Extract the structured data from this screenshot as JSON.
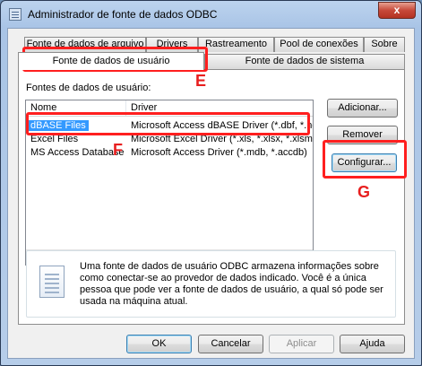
{
  "window": {
    "title": "Administrador de fonte de dados ODBC",
    "close_glyph": "x"
  },
  "tabs_back": [
    {
      "label": "Fonte de dados de arquivo"
    },
    {
      "label": "Drivers"
    },
    {
      "label": "Rastreamento"
    },
    {
      "label": "Pool de conexões"
    },
    {
      "label": "Sobre"
    }
  ],
  "tabs_front": [
    {
      "label": "Fonte de dados de usuário"
    },
    {
      "label": "Fonte de dados de sistema"
    }
  ],
  "panel": {
    "list_label": "Fontes de dados de usuário:",
    "columns": [
      "Nome",
      "Driver"
    ],
    "rows": [
      {
        "name": "dBASE Files",
        "driver": "Microsoft Access dBASE Driver (*.dbf, *.ndx"
      },
      {
        "name": "Excel Files",
        "driver": "Microsoft Excel Driver (*.xls, *.xlsx, *.xlsm, *.xlsb)"
      },
      {
        "name": "MS Access Database",
        "driver": "Microsoft Access Driver (*.mdb, *.accdb)"
      }
    ],
    "selected_row": 0,
    "buttons": {
      "add": "Adicionar...",
      "remove": "Remover",
      "configure": "Configurar..."
    },
    "info_text": "Uma fonte de dados de usuário ODBC armazena informações sobre como conectar-se ao provedor de dados indicado. Você é a única pessoa que pode ver a fonte de dados de usuário, a qual só pode ser usada na máquina atual."
  },
  "footer_buttons": {
    "ok": "OK",
    "cancel": "Cancelar",
    "apply": "Aplicar",
    "help": "Ajuda"
  },
  "annotations": {
    "tab_letter": "E",
    "row_letter": "F",
    "button_letter": "G",
    "color": "#ff1f1f"
  },
  "icons": {
    "window_icon": "odbc-window-icon",
    "info_icon": "document-icon"
  }
}
